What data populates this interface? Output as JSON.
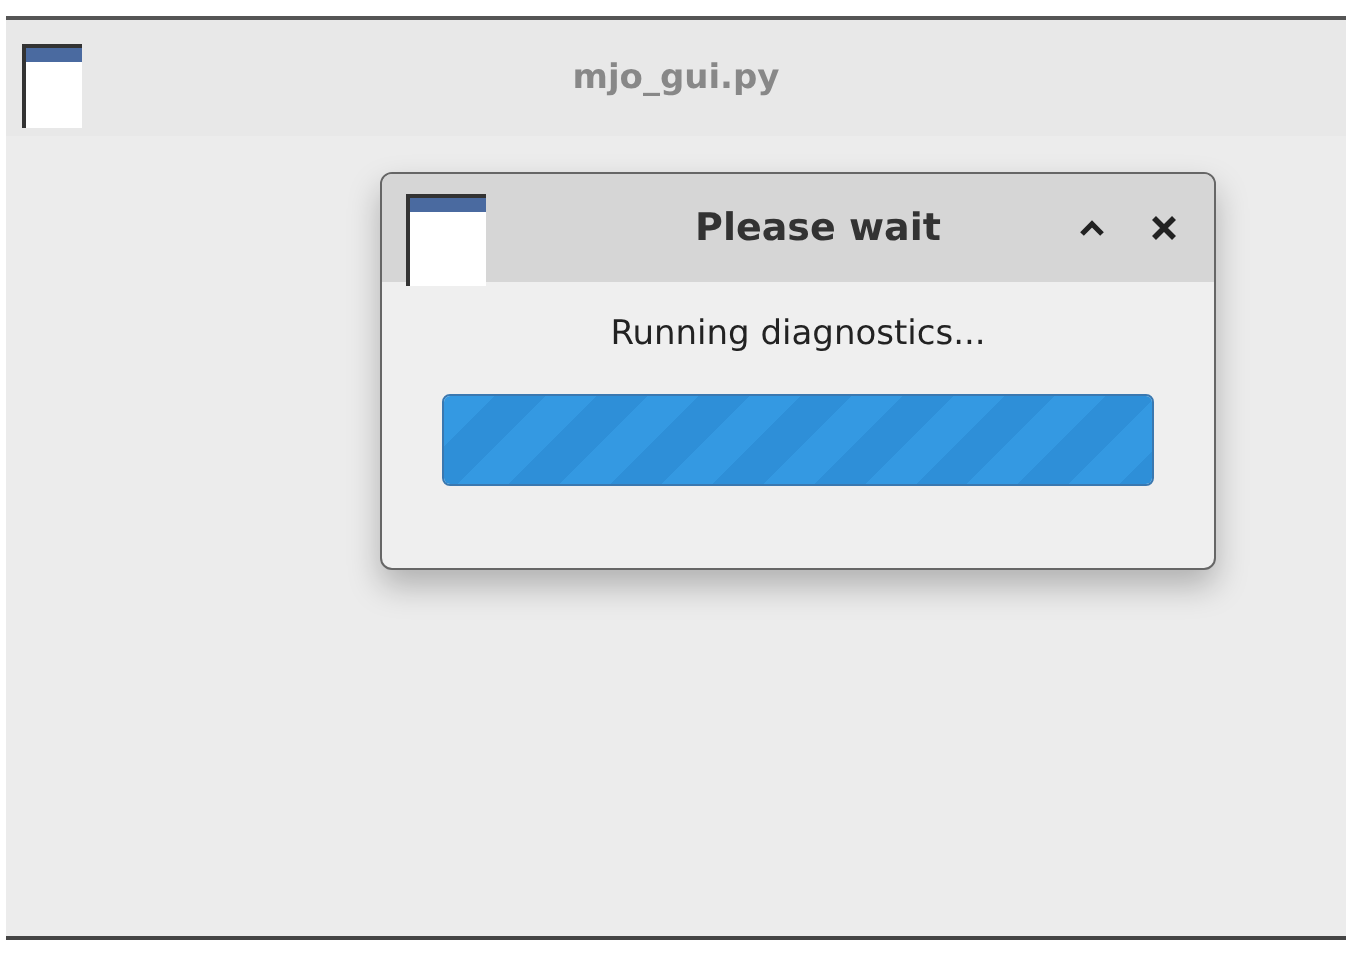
{
  "window": {
    "title": "mjo_gui.py"
  },
  "dialog": {
    "title": "Please wait",
    "message": "Running diagnostics...",
    "progress": {
      "level": 1
    }
  }
}
